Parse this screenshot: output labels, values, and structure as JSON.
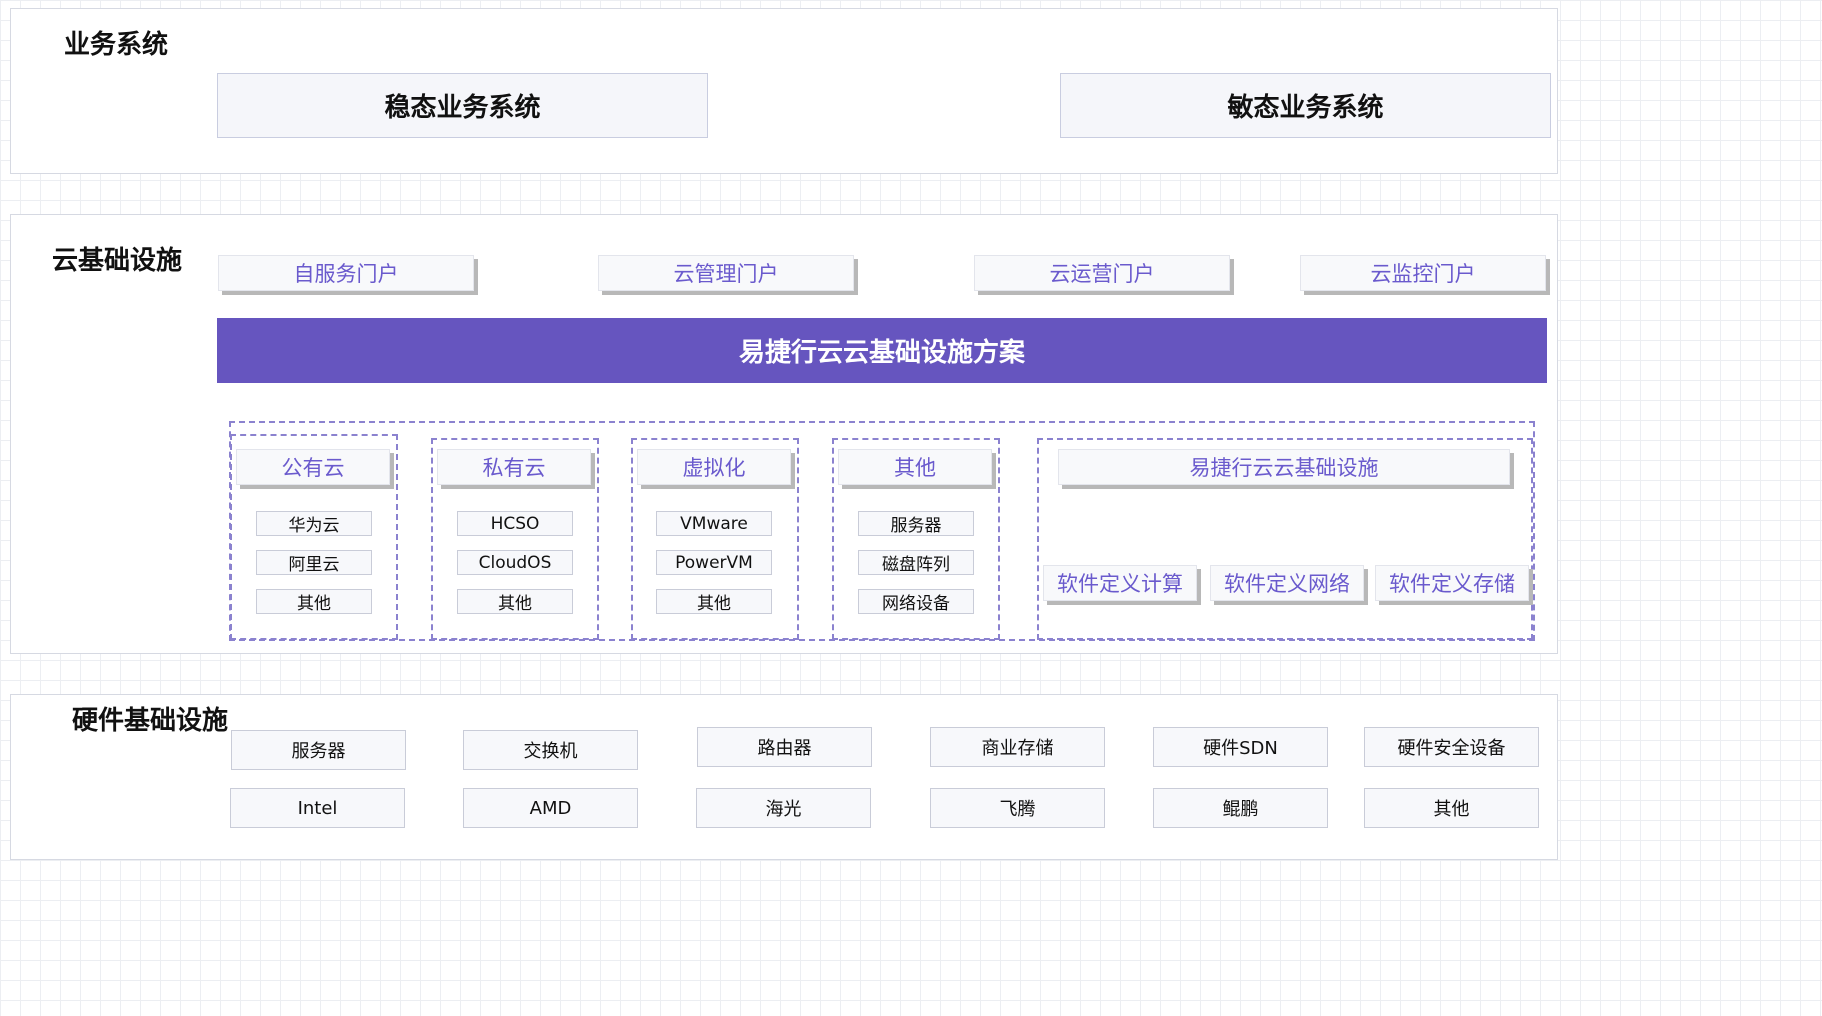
{
  "business": {
    "title": "业务系统",
    "stable": "稳态业务系统",
    "agile": "敏态业务系统"
  },
  "cloud": {
    "title": "云基础设施",
    "portals": [
      "自服务门户",
      "云管理门户",
      "云运营门户",
      "云监控门户"
    ],
    "banner": "易捷行云云基础设施方案",
    "groups": [
      {
        "header": "公有云",
        "items": [
          "华为云",
          "阿里云",
          "其他"
        ]
      },
      {
        "header": "私有云",
        "items": [
          "HCSO",
          "CloudOS",
          "其他"
        ]
      },
      {
        "header": "虚拟化",
        "items": [
          "VMware",
          "PowerVM",
          "其他"
        ]
      },
      {
        "header": "其他",
        "items": [
          "服务器",
          "磁盘阵列",
          "网络设备"
        ]
      }
    ],
    "infra": {
      "header": "易捷行云云基础设施",
      "items": [
        "软件定义计算",
        "软件定义网络",
        "软件定义存储"
      ]
    }
  },
  "hardware": {
    "title": "硬件基础设施",
    "row1": [
      "服务器",
      "交换机",
      "路由器",
      "商业存储",
      "硬件SDN",
      "硬件安全设备"
    ],
    "row2": [
      "Intel",
      "AMD",
      "海光",
      "飞腾",
      "鲲鹏",
      "其他"
    ]
  },
  "colors": {
    "accent": "#6655bf",
    "portal_text": "#6a5acd",
    "dashed_border": "#8b82cf"
  }
}
